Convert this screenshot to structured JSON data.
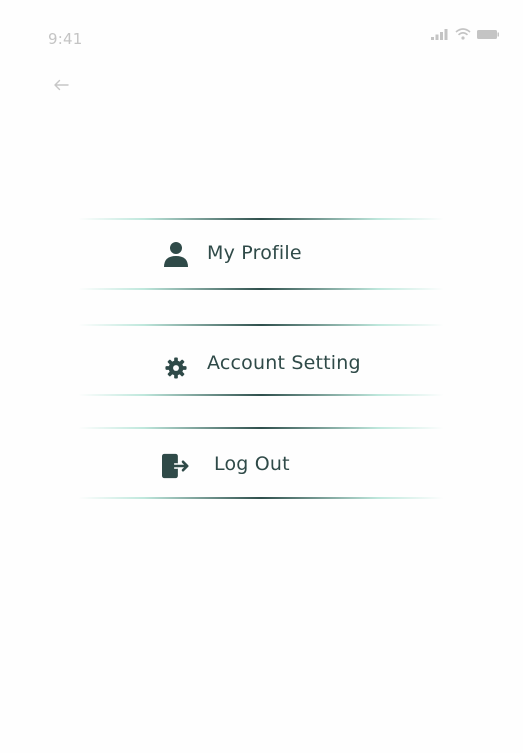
{
  "status_bar": {
    "time": "9:41",
    "icons": [
      "signal-icon",
      "wifi-icon",
      "battery-icon"
    ]
  },
  "nav": {
    "back_icon": "arrow-left-icon"
  },
  "menu": {
    "items": [
      {
        "label": "My Profile",
        "icon": "user-icon"
      },
      {
        "label": "Account Setting",
        "icon": "gear-icon"
      },
      {
        "label": "Log Out",
        "icon": "logout-icon"
      }
    ]
  },
  "colors": {
    "text": "#2f4a48",
    "icon": "#2f4a48",
    "divider_center": "#2f4f4c",
    "divider_edge": "#afe2d4",
    "status_gray": "#c4c4c4"
  }
}
